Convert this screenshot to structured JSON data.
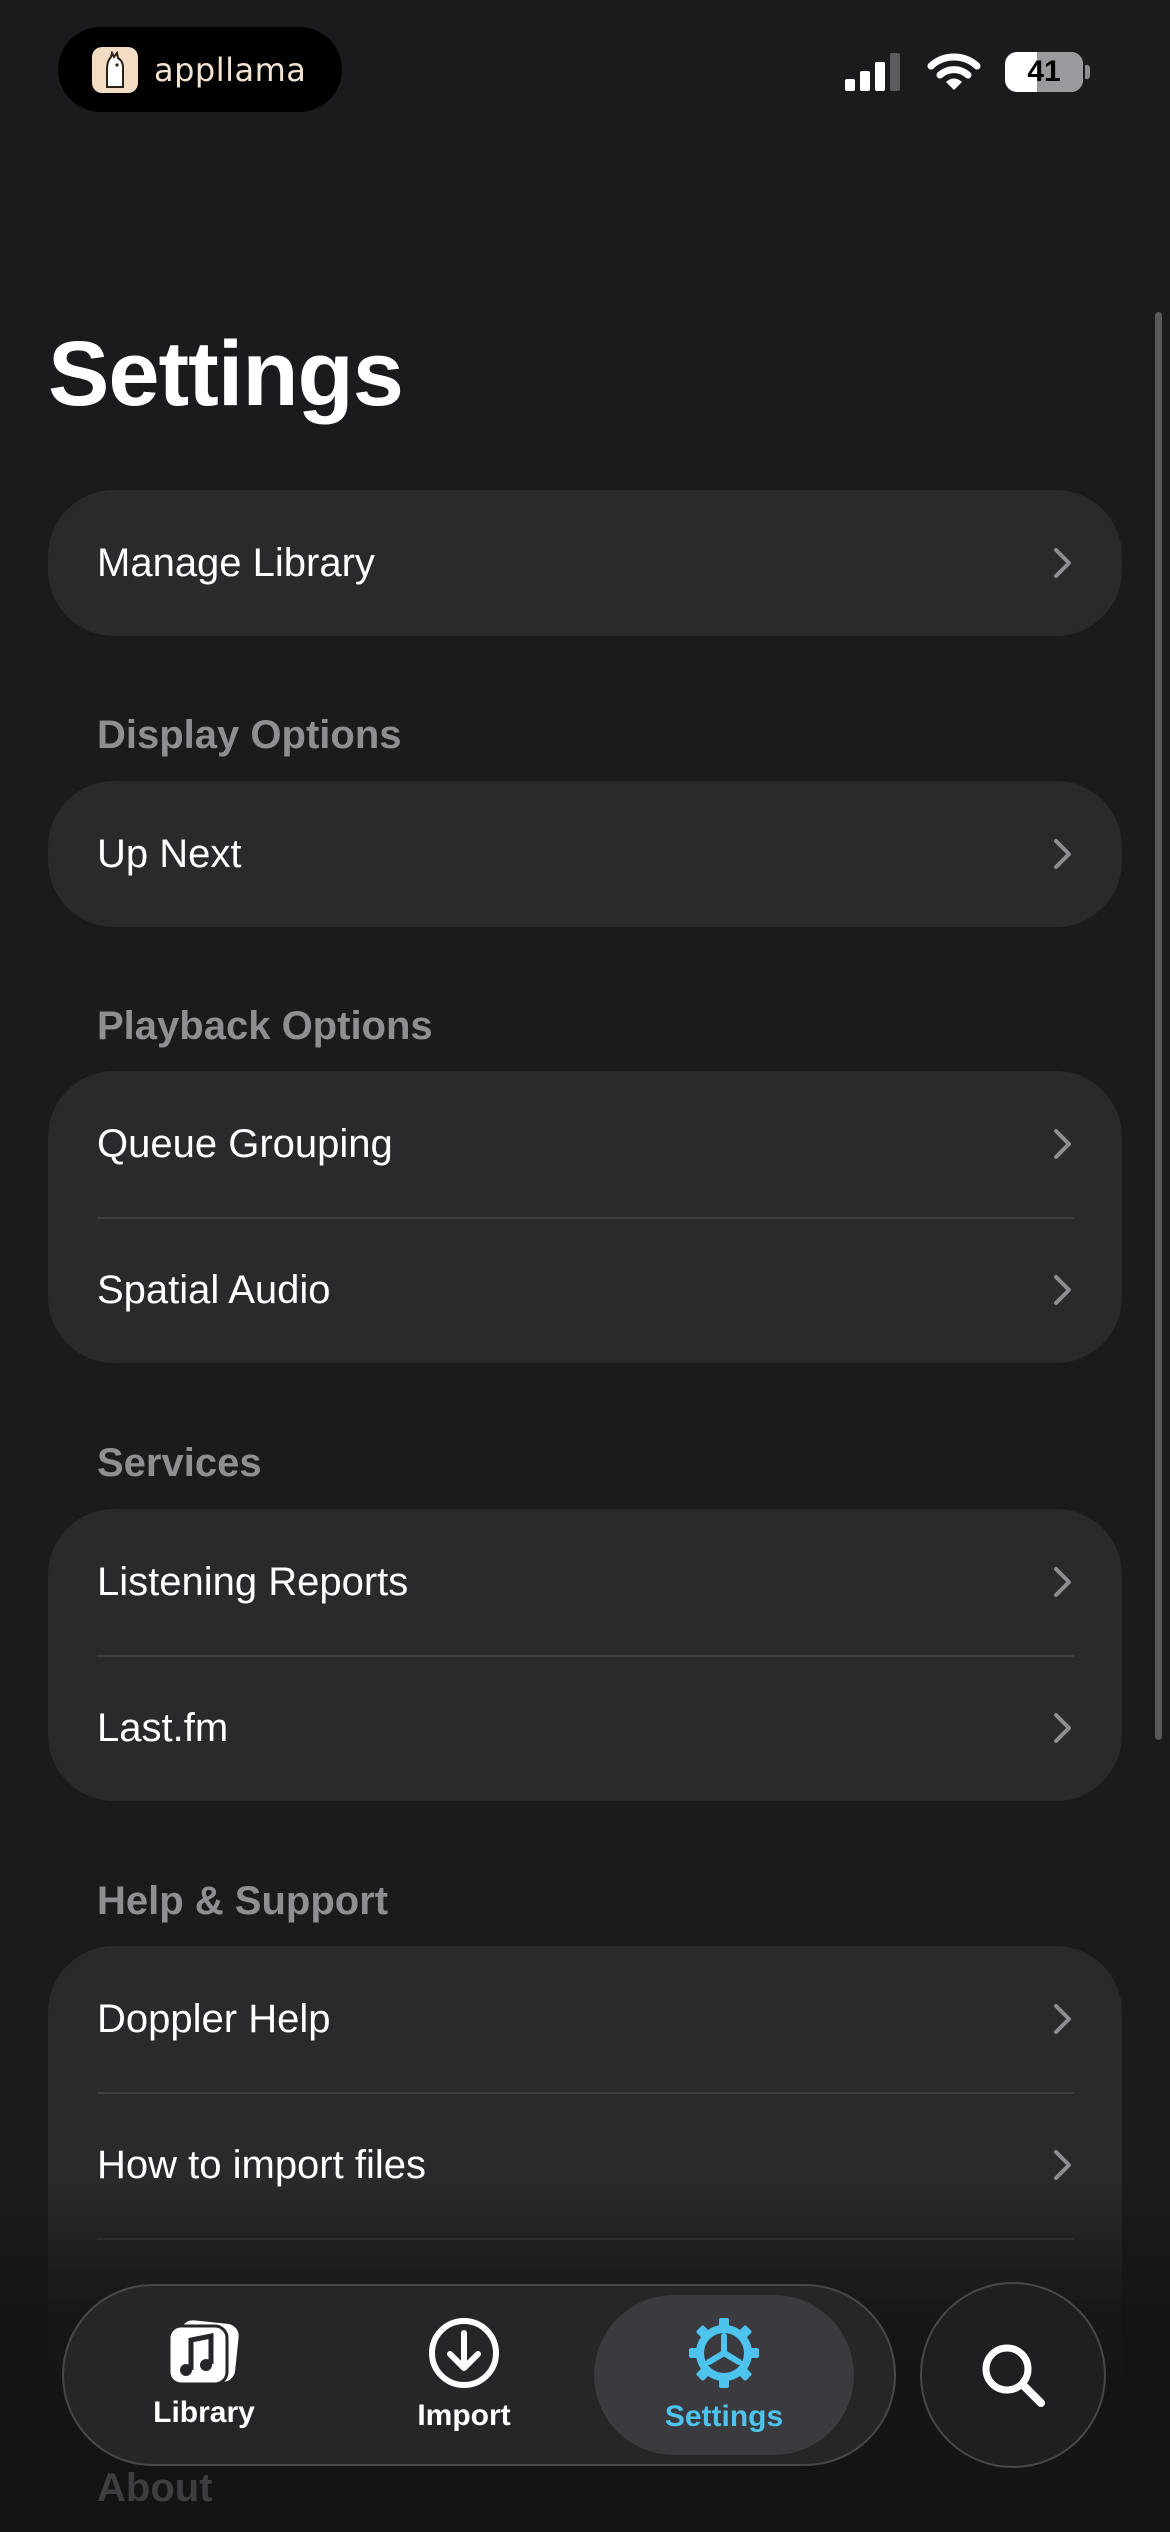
{
  "status_bar": {
    "app_badge_text": "appllama",
    "battery_level": "41"
  },
  "page_title": "Settings",
  "groups": {
    "manage": {
      "items": [
        {
          "label": "Manage Library"
        }
      ]
    },
    "display": {
      "header": "Display Options",
      "items": [
        {
          "label": "Up Next"
        }
      ]
    },
    "playback": {
      "header": "Playback Options",
      "items": [
        {
          "label": "Queue Grouping"
        },
        {
          "label": "Spatial Audio"
        }
      ]
    },
    "services": {
      "header": "Services",
      "items": [
        {
          "label": "Listening Reports"
        },
        {
          "label": "Last.fm"
        }
      ]
    },
    "help": {
      "header": "Help & Support",
      "items": [
        {
          "label": "Doppler Help"
        },
        {
          "label": "How to import files"
        }
      ]
    },
    "about": {
      "header": "About"
    }
  },
  "tab_bar": {
    "tabs": [
      {
        "label": "Library",
        "icon": "music-note-icon"
      },
      {
        "label": "Import",
        "icon": "download-circle-icon"
      },
      {
        "label": "Settings",
        "icon": "gear-icon",
        "active": true
      }
    ],
    "search_icon": "search-icon"
  },
  "colors": {
    "background": "#1b1b1d",
    "group_background": "#2a2a2d",
    "accent": "#4ec3ee",
    "section_header": "#8e8e93"
  }
}
